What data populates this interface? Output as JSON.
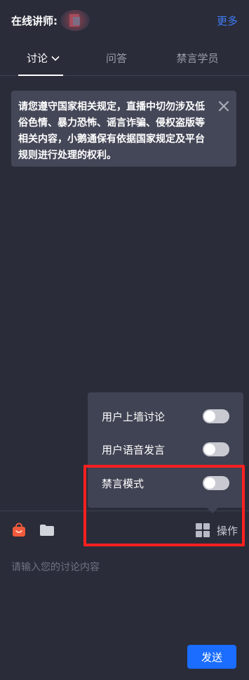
{
  "header": {
    "title": "在线讲师:",
    "more_label": "更多"
  },
  "tabs": [
    {
      "label": "讨论"
    },
    {
      "label": "问答"
    },
    {
      "label": "禁言学员"
    }
  ],
  "notice": {
    "text": "请您遵守国家相关规定，直播中切勿涉及低俗色情、暴力恐怖、谣言诈骗、侵权盗版等相关内容，小鹅通保有依据国家规定及平台规则进行处理的权利。"
  },
  "popup": {
    "items": [
      {
        "label": "用户上墙讨论",
        "on": false
      },
      {
        "label": "用户语音发言",
        "on": false
      },
      {
        "label": "禁言模式",
        "on": false
      }
    ]
  },
  "toolbar": {
    "icons": [
      "shop-bag-icon",
      "folder-icon",
      "grid-icon"
    ],
    "ops_label": "操作"
  },
  "input": {
    "placeholder": "请输入您的讨论内容"
  },
  "send_label": "发送",
  "colors": {
    "background": "#2a2c39",
    "accent": "#1a6dff",
    "link": "#3f7cf5",
    "highlight": "#ff2020"
  }
}
